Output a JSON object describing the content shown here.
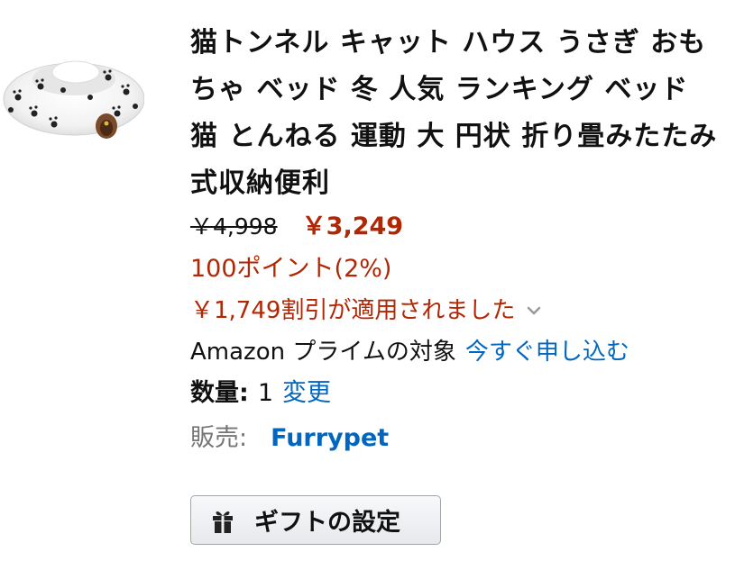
{
  "product": {
    "title": "猫トンネル キャット ハウス うさぎ おもちゃ ベッド 冬 人気 ランキング ベッド 猫 とんねる 運動 大 円状 折り畳みたたみ式収納便利",
    "image_alt": "cat tunnel bed (white with black paw prints)",
    "list_price": "￥4,998",
    "deal_price": "￥3,249",
    "points": "100ポイント(2%)",
    "discount_text": "￥1,749割引が適用されました",
    "prime_text": "Amazon プライムの対象",
    "prime_link": "今すぐ申し込む",
    "quantity_label": "数量:",
    "quantity_value": "1",
    "quantity_change": "変更",
    "seller_label": "販売:",
    "seller_name": "Furrypet"
  },
  "gift_button": {
    "label": "ギフトの設定",
    "icon": "gift-icon"
  },
  "colors": {
    "price_red": "#b12704",
    "link_blue": "#0066c0",
    "muted_gray": "#767676",
    "button_border": "#a2a6ac"
  }
}
